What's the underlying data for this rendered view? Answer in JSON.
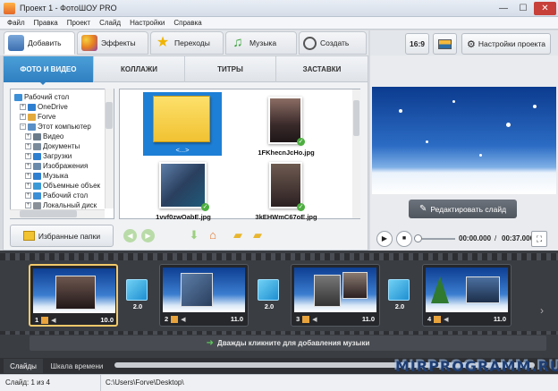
{
  "window": {
    "title": "Проект 1 - ФотоШОУ PRO",
    "min": "—",
    "max": "☐",
    "close": "✕"
  },
  "menu": [
    "Файл",
    "Правка",
    "Проект",
    "Слайд",
    "Настройки",
    "Справка"
  ],
  "main_tabs": [
    {
      "label": "Добавить",
      "icon": "add-photo-icon"
    },
    {
      "label": "Эффекты",
      "icon": "palette-icon"
    },
    {
      "label": "Переходы",
      "icon": "star-icon"
    },
    {
      "label": "Музыка",
      "icon": "music-note-icon"
    },
    {
      "label": "Создать",
      "icon": "film-reel-icon"
    }
  ],
  "toolbar": {
    "aspect": "16:9",
    "settings": "Настройки проекта"
  },
  "sub_tabs": [
    "ФОТО И ВИДЕО",
    "КОЛЛАЖИ",
    "ТИТРЫ",
    "ЗАСТАВКИ"
  ],
  "tree": [
    {
      "label": "Рабочий стол",
      "level": 0,
      "exp": "",
      "color": "#3b8fd6"
    },
    {
      "label": "OneDrive",
      "level": 1,
      "exp": "+",
      "color": "#2f7fd0"
    },
    {
      "label": "Forve",
      "level": 1,
      "exp": "+",
      "color": "#e2a93c"
    },
    {
      "label": "Этот компьютер",
      "level": 1,
      "exp": "−",
      "color": "#5a90c6"
    },
    {
      "label": "Видео",
      "level": 2,
      "exp": "+",
      "color": "#6a7b8c"
    },
    {
      "label": "Документы",
      "level": 2,
      "exp": "+",
      "color": "#7a8b9c"
    },
    {
      "label": "Загрузки",
      "level": 2,
      "exp": "+",
      "color": "#2f7fd0"
    },
    {
      "label": "Изображения",
      "level": 2,
      "exp": "+",
      "color": "#6a8aac"
    },
    {
      "label": "Музыка",
      "level": 2,
      "exp": "+",
      "color": "#2f7fd0"
    },
    {
      "label": "Объемные объек",
      "level": 2,
      "exp": "+",
      "color": "#3b9ad6"
    },
    {
      "label": "Рабочий стол",
      "level": 2,
      "exp": "+",
      "color": "#3b8fd6"
    },
    {
      "label": "Локальный диск",
      "level": 2,
      "exp": "+",
      "color": "#8a9098"
    }
  ],
  "files": [
    {
      "label": "<...>",
      "kind": "folder"
    },
    {
      "label": "1FKhecnJcHo.jpg",
      "kind": "photo"
    },
    {
      "label": "1vvf0zwOabE.jpg",
      "kind": "photo"
    },
    {
      "label": "3kEHWmC67oE.jpg",
      "kind": "photo"
    }
  ],
  "favorites_button": "Избранные папки",
  "preview": {
    "edit_button": "Редактировать слайд",
    "time_current": "00:00.000",
    "time_sep": "/",
    "time_total": "00:37.000"
  },
  "slides": [
    {
      "num": "1",
      "duration": "10.0"
    },
    {
      "num": "2",
      "duration": "11.0"
    },
    {
      "num": "3",
      "duration": "11.0"
    },
    {
      "num": "4",
      "duration": "11.0"
    }
  ],
  "transitions": [
    "2.0",
    "2.0",
    "2.0"
  ],
  "music_hint": "Дважды кликните для добавления музыки",
  "bottom_tabs": [
    "Слайды",
    "Шкала времени"
  ],
  "status": {
    "slide": "Слайд: 1 из 4",
    "path": "C:\\Users\\Forve\\Desktop\\"
  },
  "watermark": "MIRPROGRAMM.RU",
  "colors": {
    "accent": "#2f7fc0",
    "timeline": "#3a3d42",
    "close": "#c7403a",
    "check": "#4cae3f"
  }
}
